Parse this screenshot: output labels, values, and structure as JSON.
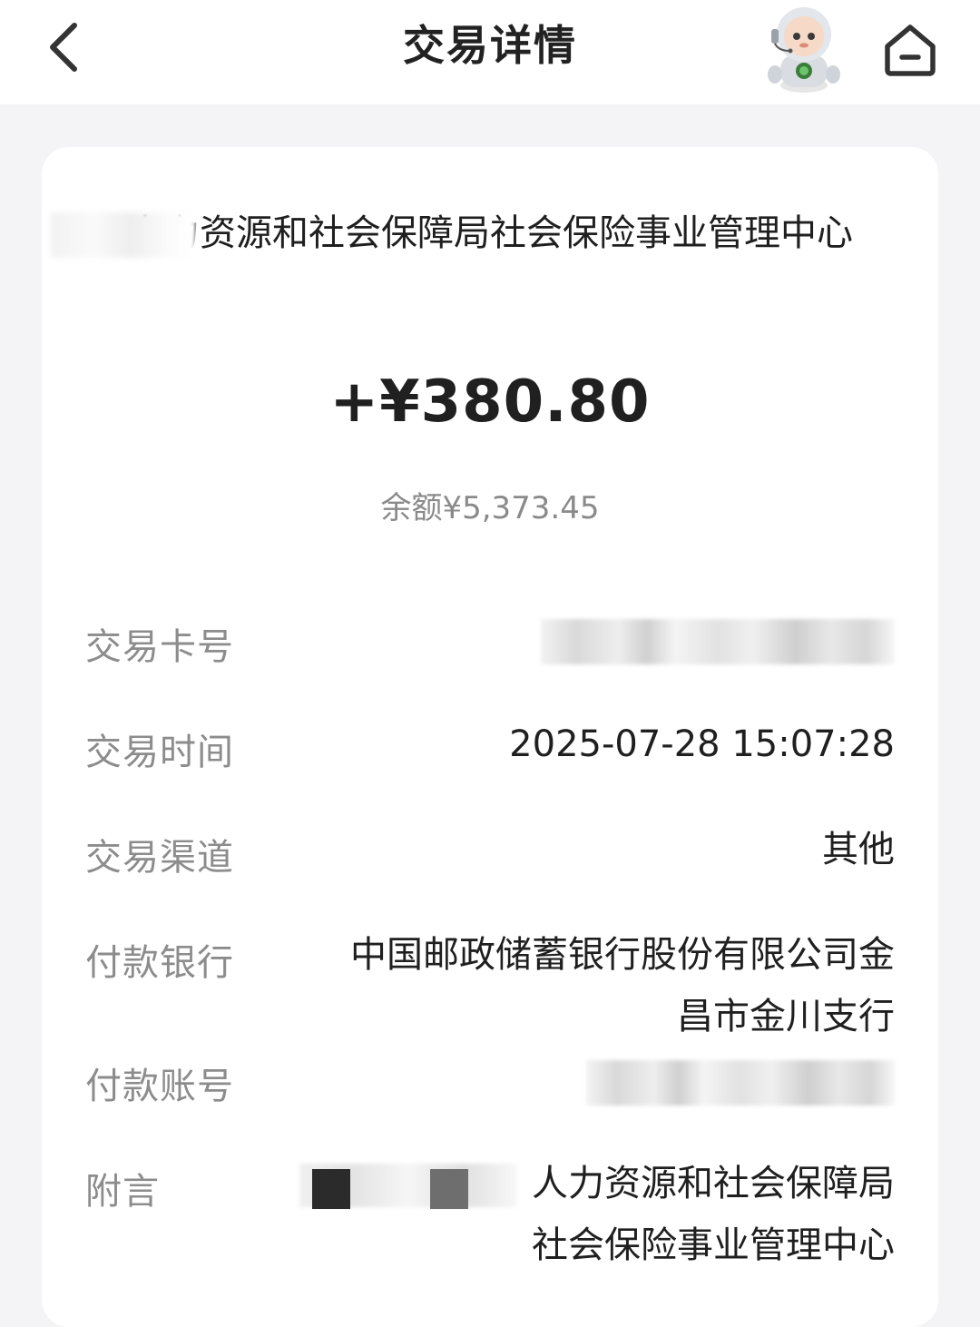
{
  "header": {
    "title": "交易详情",
    "back_icon": "chevron-left-icon",
    "assistant_icon": "robot-assistant-icon",
    "home_icon": "home-icon"
  },
  "transaction": {
    "payer_name": "人力资源和社会保障局社会保险事业管理中心",
    "amount": "+¥380.80",
    "balance": "余额¥5,373.45"
  },
  "details": {
    "card_no_label": "交易卡号",
    "time_label": "交易时间",
    "time_value": "2025-07-28 15:07:28",
    "channel_label": "交易渠道",
    "channel_value": "其他",
    "bank_label": "付款银行",
    "bank_value_line1": "中国邮政储蓄银行股份有限公司金",
    "bank_value_line2": "昌市金川支行",
    "account_label": "付款账号",
    "memo_label": "附言",
    "memo_value_line1": "人力资源和社会保障局",
    "memo_value_line2": "社会保险事业管理中心"
  },
  "colors": {
    "background": "#f4f4f6",
    "card": "#ffffff",
    "label_text": "#8c8c8c",
    "value_text": "#1f1f1f"
  }
}
